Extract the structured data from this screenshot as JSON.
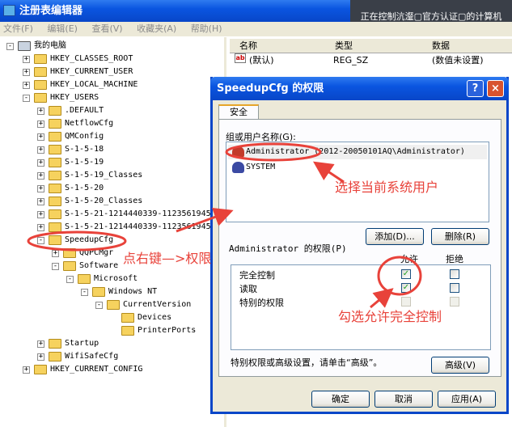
{
  "window": {
    "title": "注册表编辑器",
    "remote_banner": "正在控制沆瀣▢官方认证▢的计算机"
  },
  "menu": [
    "文件(F)",
    "编辑(E)",
    "查看(V)",
    "收藏夹(A)",
    "帮助(H)"
  ],
  "tree": [
    {
      "label": "我的电脑",
      "level": 0,
      "exp": "-"
    },
    {
      "label": "HKEY_CLASSES_ROOT",
      "level": 1,
      "exp": "+"
    },
    {
      "label": "HKEY_CURRENT_USER",
      "level": 1,
      "exp": "+"
    },
    {
      "label": "HKEY_LOCAL_MACHINE",
      "level": 1,
      "exp": "+"
    },
    {
      "label": "HKEY_USERS",
      "level": 1,
      "exp": "-"
    },
    {
      "label": ".DEFAULT",
      "level": 2,
      "exp": "+"
    },
    {
      "label": "NetflowCfg",
      "level": 2,
      "exp": "+"
    },
    {
      "label": "QMConfig",
      "level": 2,
      "exp": "+"
    },
    {
      "label": "S-1-5-18",
      "level": 2,
      "exp": "+"
    },
    {
      "label": "S-1-5-19",
      "level": 2,
      "exp": "+"
    },
    {
      "label": "S-1-5-19_Classes",
      "level": 2,
      "exp": "+"
    },
    {
      "label": "S-1-5-20",
      "level": 2,
      "exp": "+"
    },
    {
      "label": "S-1-5-20_Classes",
      "level": 2,
      "exp": "+"
    },
    {
      "label": "S-1-5-21-1214440339-1123561945",
      "level": 2,
      "exp": "+"
    },
    {
      "label": "S-1-5-21-1214440339-1123561945",
      "level": 2,
      "exp": "+"
    },
    {
      "label": "SpeedupCfg",
      "level": 2,
      "exp": "-"
    },
    {
      "label": "QQPCMgr",
      "level": 3,
      "exp": "+"
    },
    {
      "label": "Software",
      "level": 3,
      "exp": "-"
    },
    {
      "label": "Microsoft",
      "level": 4,
      "exp": "-"
    },
    {
      "label": "Windows NT",
      "level": 5,
      "exp": "-"
    },
    {
      "label": "CurrentVersion",
      "level": 6,
      "exp": "-"
    },
    {
      "label": "Devices",
      "level": 7,
      "exp": ""
    },
    {
      "label": "PrinterPorts",
      "level": 7,
      "exp": ""
    },
    {
      "label": "Startup",
      "level": 2,
      "exp": "+"
    },
    {
      "label": "WifiSafeCfg",
      "level": 2,
      "exp": "+"
    },
    {
      "label": "HKEY_CURRENT_CONFIG",
      "level": 1,
      "exp": "+"
    }
  ],
  "list": {
    "headers": {
      "name": "名称",
      "type": "类型",
      "data": "数据"
    },
    "row": {
      "icon": "ab",
      "name": "(默认)",
      "type": "REG_SZ",
      "data": "(数值未设置)"
    }
  },
  "dialog": {
    "title": "SpeedupCfg 的权限",
    "help": "?",
    "close": "×",
    "tab": "安全",
    "group_label": "组或用户名称(G):",
    "users": [
      "Administrator (2012-20050101AQ\\Administrator)",
      "SYSTEM"
    ],
    "add_button": "添加(D)...",
    "remove_button": "删除(R)",
    "perm_label": "Administrator 的权限(P)",
    "allow": "允许",
    "deny": "拒绝",
    "perms": [
      {
        "name": "完全控制",
        "allow": true,
        "deny": false,
        "allow_disabled": false,
        "deny_disabled": false
      },
      {
        "name": "读取",
        "allow": true,
        "deny": false,
        "allow_disabled": false,
        "deny_disabled": false
      },
      {
        "name": "特别的权限",
        "allow": false,
        "deny": false,
        "allow_disabled": true,
        "deny_disabled": true
      }
    ],
    "note": "特别权限或高级设置，请单击“高级”。",
    "advanced_button": "高级(V)",
    "ok_button": "确定",
    "cancel_button": "取消",
    "apply_button": "应用(A)"
  },
  "annotations": {
    "choose_user": "选择当前系统用户",
    "right_click": "点右键—>权限",
    "check_allow": "勾选允许完全控制"
  },
  "colors": {
    "annotation": "#e8423a",
    "titlebar": "#0a55e0"
  }
}
